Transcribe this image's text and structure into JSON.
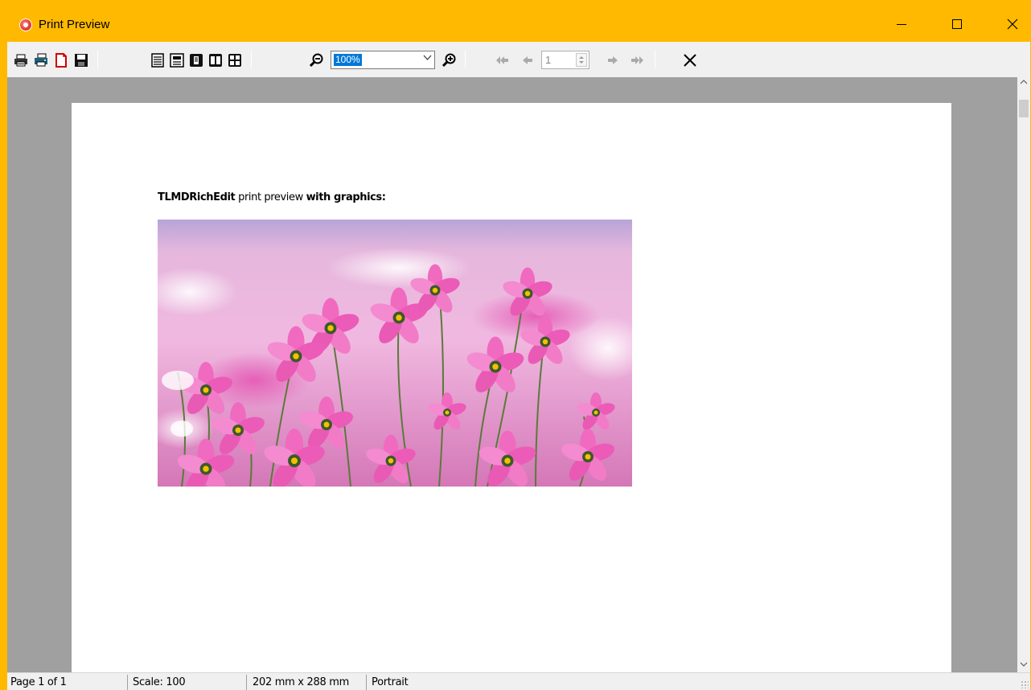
{
  "window": {
    "title": "Print Preview",
    "title_bar_color": "#ffb900"
  },
  "toolbar": {
    "buttons": [
      {
        "name": "print-icon"
      },
      {
        "name": "print-setup-icon"
      },
      {
        "name": "pdf-export-icon"
      },
      {
        "name": "save-icon"
      },
      {
        "name": "one-page-view-icon"
      },
      {
        "name": "page-width-icon"
      },
      {
        "name": "whole-page-icon"
      },
      {
        "name": "two-pages-icon"
      },
      {
        "name": "multiple-pages-icon"
      },
      {
        "name": "zoom-out-icon"
      },
      {
        "name": "zoom-in-icon"
      },
      {
        "name": "first-page-icon"
      },
      {
        "name": "previous-page-icon"
      },
      {
        "name": "next-page-icon"
      },
      {
        "name": "last-page-icon"
      },
      {
        "name": "close-preview-icon"
      }
    ],
    "zoom_value": "100%",
    "page_number": "1"
  },
  "document": {
    "text_bold_1": "TLMDRichEdit",
    "text_regular": " print preview ",
    "text_bold_2": "with graphics:",
    "image_subject": "pink cosmos flowers field"
  },
  "statusbar": {
    "page": "Page 1 of 1",
    "scale": "Scale: 100",
    "size": "202 mm x 288 mm",
    "orientation": "Portrait"
  }
}
